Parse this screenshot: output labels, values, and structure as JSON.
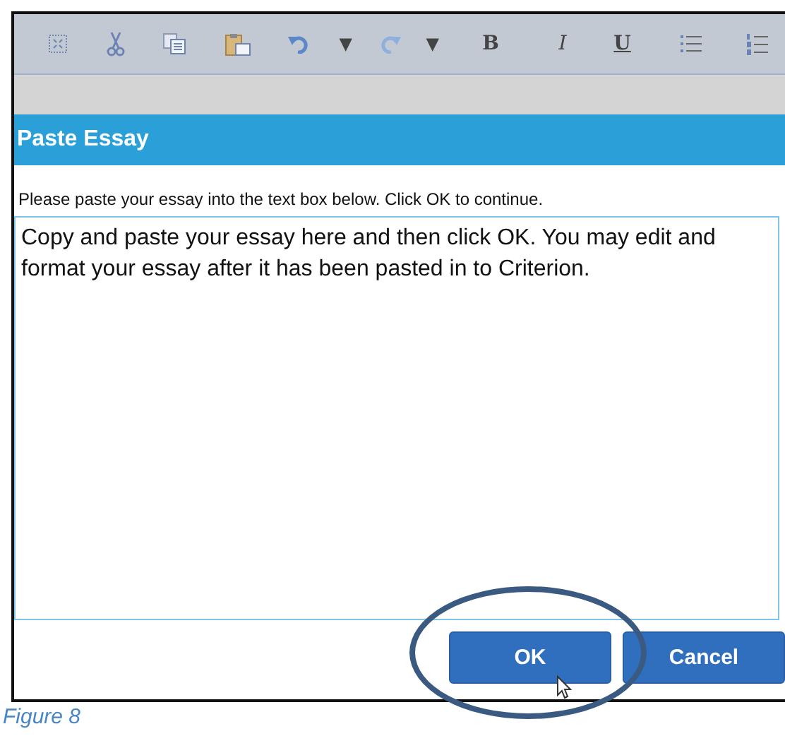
{
  "toolbar": [
    {
      "kind": "select-all"
    },
    {
      "kind": "cut"
    },
    {
      "kind": "copy"
    },
    {
      "kind": "paste"
    },
    {
      "kind": "undo"
    },
    {
      "kind": "dropdown",
      "label": "▼"
    },
    {
      "kind": "redo"
    },
    {
      "kind": "dropdown",
      "label": "▼"
    },
    {
      "kind": "bold",
      "label": "B"
    },
    {
      "kind": "italic",
      "label": "I"
    },
    {
      "kind": "underline",
      "label": "U"
    },
    {
      "kind": "bullets"
    },
    {
      "kind": "numbers"
    }
  ],
  "dialog": {
    "title": "Paste Essay",
    "instruction": "Please paste your essay into the text box below. Click OK to continue.",
    "value": "Copy and paste your essay here and then click OK. You may edit and format your essay after it has been pasted in to Criterion.",
    "buttons": [
      {
        "label": "OK",
        "highlighted": true
      },
      {
        "label": "Cancel",
        "highlighted": false
      }
    ]
  },
  "caption": "Figure 8"
}
